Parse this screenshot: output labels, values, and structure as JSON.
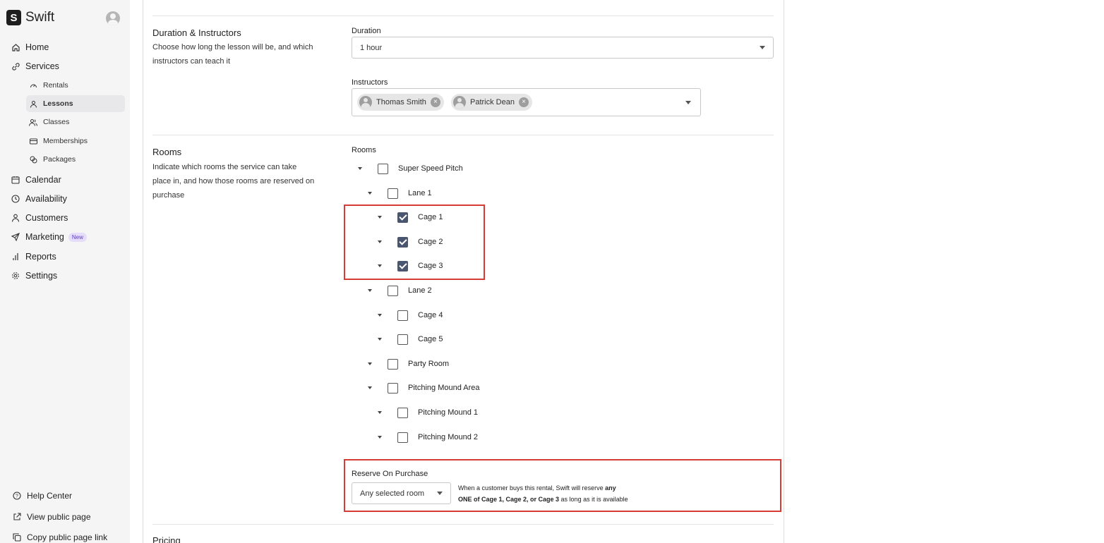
{
  "app": {
    "logo_letter": "S",
    "name": "Swift"
  },
  "nav": {
    "home": "Home",
    "services": "Services",
    "sub": {
      "rentals": "Rentals",
      "lessons": "Lessons",
      "classes": "Classes",
      "memberships": "Memberships",
      "packages": "Packages"
    },
    "calendar": "Calendar",
    "availability": "Availability",
    "customers": "Customers",
    "marketing": "Marketing",
    "marketing_badge": "New",
    "reports": "Reports",
    "settings": "Settings"
  },
  "footer_nav": {
    "help": "Help Center",
    "view_public": "View public page",
    "copy_link": "Copy public page link"
  },
  "duration_section": {
    "title": "Duration & Instructors",
    "description": "Choose how long the lesson will be, and which instructors can teach it",
    "duration_label": "Duration",
    "duration_value": "1 hour",
    "instructors_label": "Instructors",
    "instructors": [
      "Thomas Smith",
      "Patrick Dean"
    ]
  },
  "rooms_section": {
    "title": "Rooms",
    "description": "Indicate which rooms the service can take place in, and how those rooms are reserved on purchase",
    "rooms_label": "Rooms",
    "tree": [
      {
        "label": "Super Speed Pitch",
        "level": 0,
        "checked": false
      },
      {
        "label": "Lane 1",
        "level": 1,
        "checked": false
      },
      {
        "label": "Cage 1",
        "level": 2,
        "checked": true
      },
      {
        "label": "Cage 2",
        "level": 2,
        "checked": true
      },
      {
        "label": "Cage 3",
        "level": 2,
        "checked": true
      },
      {
        "label": "Lane 2",
        "level": 1,
        "checked": false
      },
      {
        "label": "Cage 4",
        "level": 2,
        "checked": false
      },
      {
        "label": "Cage 5",
        "level": 2,
        "checked": false
      },
      {
        "label": "Party Room",
        "level": 1,
        "checked": false
      },
      {
        "label": "Pitching Mound Area",
        "level": 1,
        "checked": false
      },
      {
        "label": "Pitching Mound 1",
        "level": 2,
        "checked": false
      },
      {
        "label": "Pitching Mound 2",
        "level": 2,
        "checked": false
      }
    ],
    "reserve_label": "Reserve On Purchase",
    "reserve_value": "Any selected room",
    "reserve_note": {
      "line1_prefix": "When a customer buys this rental, Swift will reserve ",
      "line1_bold": "any",
      "line2_bold": "ONE of Cage 1, Cage 2, or Cage 3",
      "line2_suffix": " as long as it is available"
    }
  },
  "pricing_section": {
    "title": "Pricing"
  },
  "colors": {
    "highlight": "#d63b35",
    "checkbox_checked": "#4a5670",
    "sidebar_bg": "#f5f5f6"
  }
}
